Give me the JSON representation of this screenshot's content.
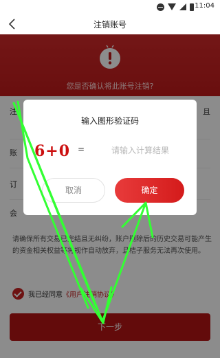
{
  "status_bar": {
    "time": "11:04"
  },
  "nav": {
    "title": "注销账号"
  },
  "hero": {
    "text": "您是否确认将此账号注销?"
  },
  "rows": [
    {
      "label": "注",
      "trail": "且"
    },
    {
      "label": "账"
    },
    {
      "label": "订"
    },
    {
      "label": "会"
    }
  ],
  "notice": "请确保所有交易已完结且无纠纷，账户删除后的历史交易可能产生的资金相关权益等将视作自动放弃，且桔子服务无法再次使用。",
  "agreement": {
    "prefix": "我已经同意",
    "link": "《用户注销协议》"
  },
  "next_button": {
    "label": "下一步"
  },
  "dialog": {
    "title": "输入图形验证码",
    "captcha_text": "6+0",
    "equals": "=",
    "input_placeholder": "请输入计算结果",
    "input_value": "",
    "cancel_label": "取消",
    "confirm_label": "确定"
  },
  "colors": {
    "brand_red": "#c62222",
    "overlay_arrow": "#33ff33"
  }
}
